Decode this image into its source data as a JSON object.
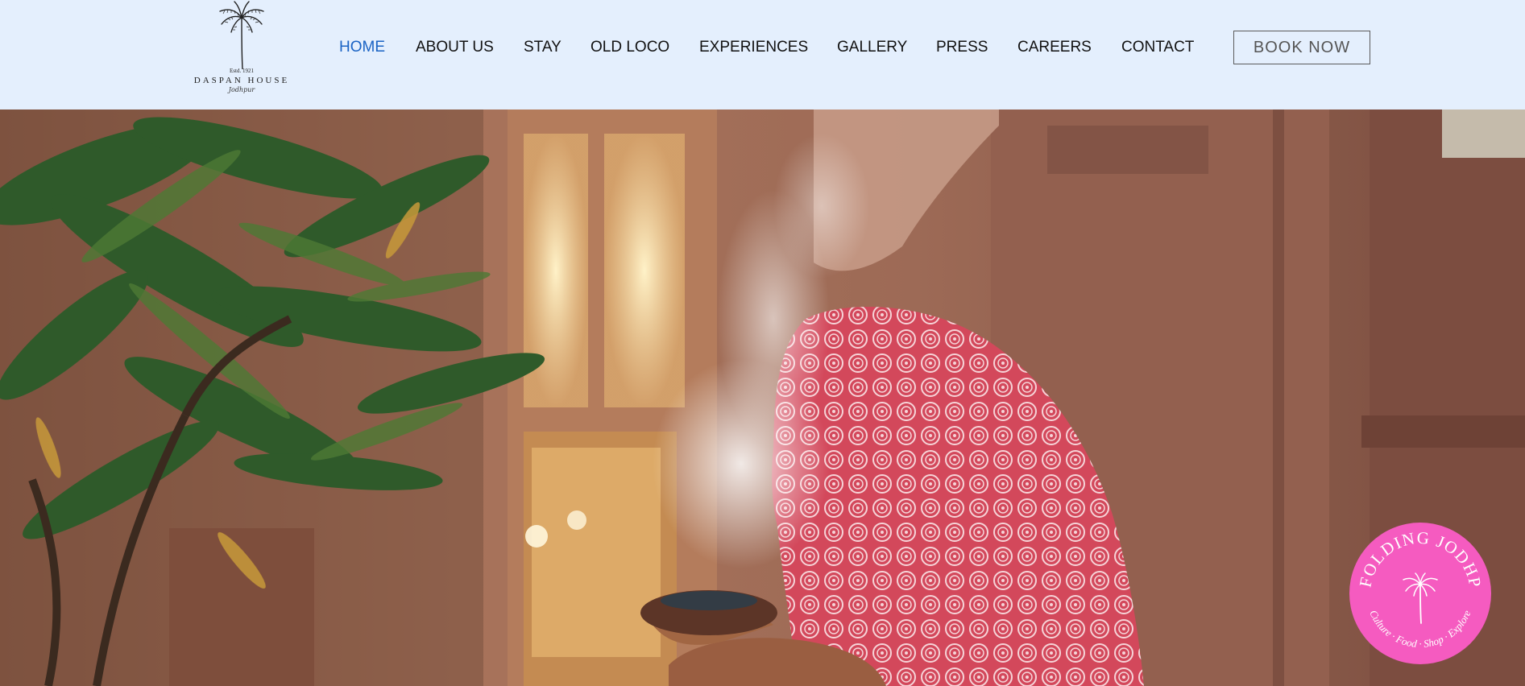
{
  "logo": {
    "est": "Estd. 1921",
    "brand": "DASPAN HOUSE",
    "city": "Jodhpur"
  },
  "nav": {
    "items": [
      {
        "label": "HOME",
        "active": true
      },
      {
        "label": "ABOUT US",
        "active": false
      },
      {
        "label": "STAY",
        "active": false
      },
      {
        "label": "OLD LOCO",
        "active": false
      },
      {
        "label": "EXPERIENCES",
        "active": false
      },
      {
        "label": "GALLERY",
        "active": false
      },
      {
        "label": "PRESS",
        "active": false
      },
      {
        "label": "CAREERS",
        "active": false
      },
      {
        "label": "CONTACT",
        "active": false
      }
    ],
    "book_label": "BOOK NOW"
  },
  "badge": {
    "top_text": "UNFOLDING JODHPUR",
    "bottom_text": "Culture · Food · Shop · Explore"
  },
  "colors": {
    "header_bg": "#e4effd",
    "active_link": "#1a63c4",
    "badge_pink": "#f55bc0"
  }
}
